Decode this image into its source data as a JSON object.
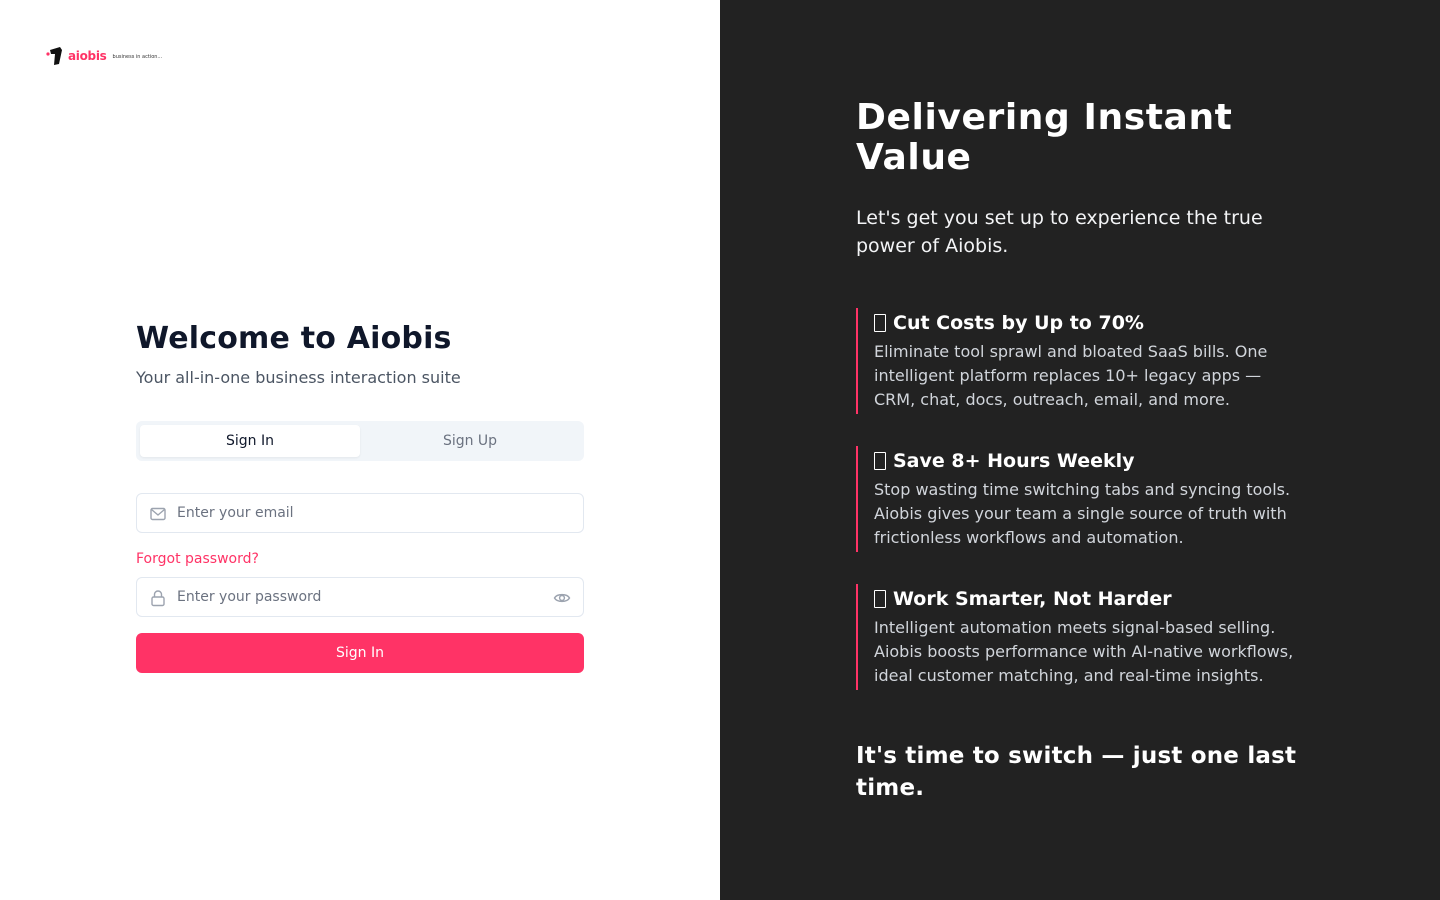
{
  "brand": {
    "name": "aiobis",
    "tagline": "business in action...",
    "accent_color": "#ff3366",
    "dark_panel_color": "#222222"
  },
  "auth": {
    "title": "Welcome to Aiobis",
    "subtitle": "Your all-in-one business interaction suite",
    "tabs": [
      {
        "label": "Sign In",
        "active": true
      },
      {
        "label": "Sign Up",
        "active": false
      }
    ],
    "email": {
      "placeholder": "Enter your email",
      "icon": "mail-icon"
    },
    "forgot_password": "Forgot password?",
    "password": {
      "placeholder": "Enter your password",
      "icon": "lock-icon",
      "toggle_icon": "eye-icon"
    },
    "submit_label": "Sign In"
  },
  "marketing": {
    "title": "Delivering Instant Value",
    "subtitle": "Let's get you set up to experience the true power of Aiobis.",
    "features": [
      {
        "icon": "emoji-placeholder-icon",
        "title": "Cut Costs by Up to 70%",
        "description": "Eliminate tool sprawl and bloated SaaS bills. One intelligent platform replaces 10+ legacy apps — CRM, chat, docs, outreach, email, and more."
      },
      {
        "icon": "emoji-placeholder-icon",
        "title": "Save 8+ Hours Weekly",
        "description": "Stop wasting time switching tabs and syncing tools. Aiobis gives your team a single source of truth with frictionless workflows and automation."
      },
      {
        "icon": "emoji-placeholder-icon",
        "title": "Work Smarter, Not Harder",
        "description": "Intelligent automation meets signal-based selling. Aiobis boosts performance with AI-native workflows, ideal customer matching, and real-time insights."
      }
    ],
    "closing": "It's time to switch — just one last time."
  }
}
